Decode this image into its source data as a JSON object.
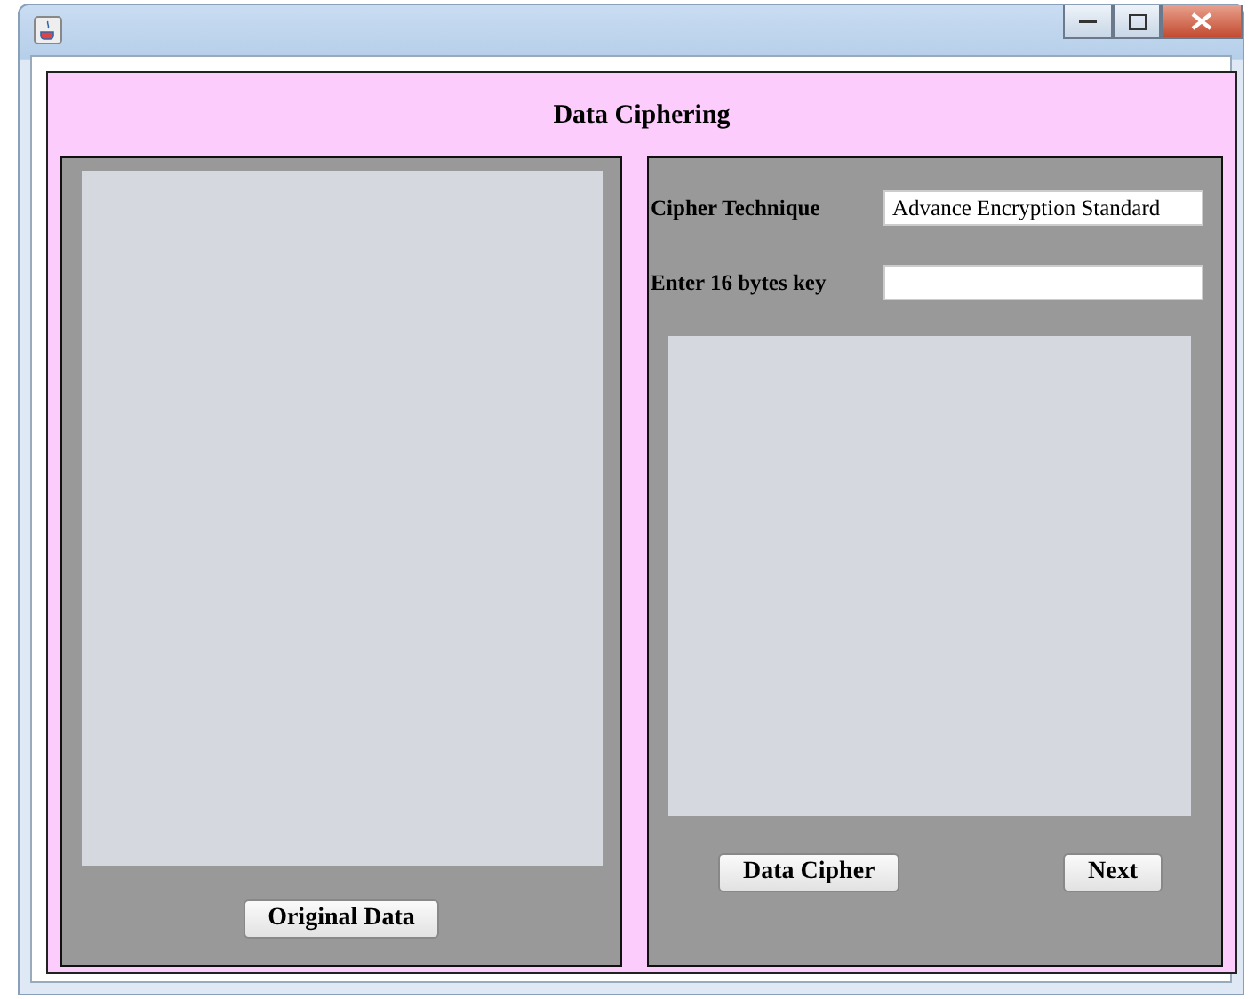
{
  "heading": "Data Ciphering",
  "left_panel": {
    "button": "Original Data"
  },
  "right_panel": {
    "fields": [
      {
        "label": "Cipher Technique",
        "value": "Advance Encryption Standard"
      },
      {
        "label": "Enter 16 bytes key"
      }
    ],
    "buttons": [
      "Data Cipher",
      "Next"
    ]
  }
}
